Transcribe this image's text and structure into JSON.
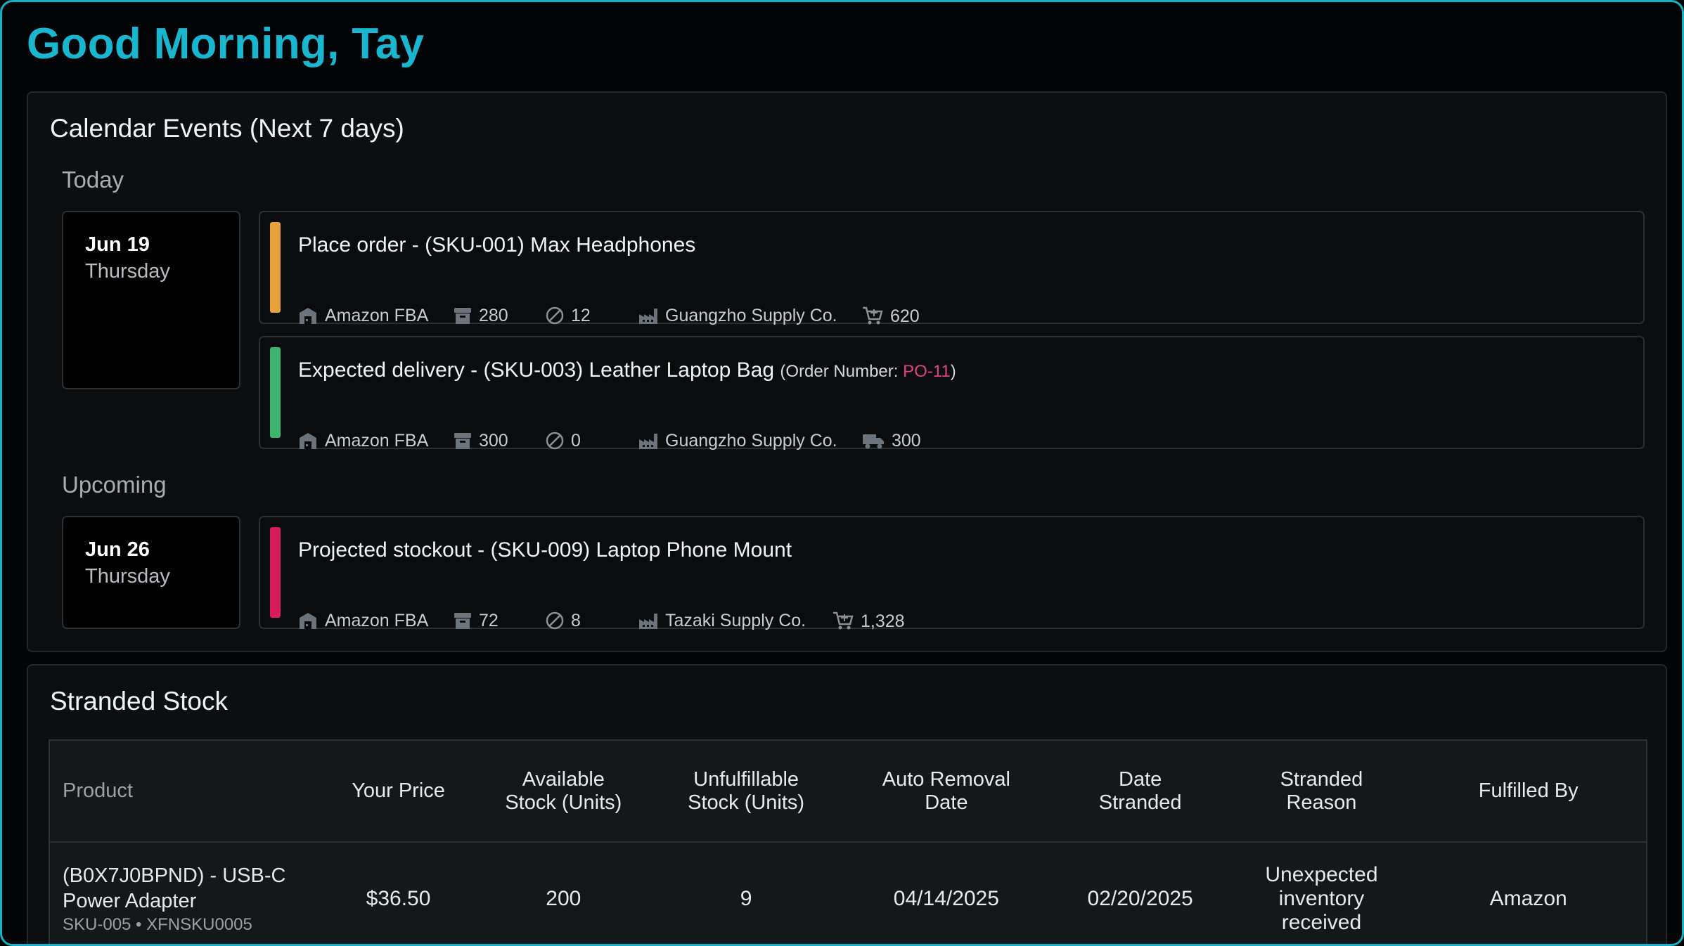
{
  "greeting": "Good Morning, Tay",
  "calendar": {
    "title": "Calendar Events (Next 7 days)",
    "today_label": "Today",
    "upcoming_label": "Upcoming",
    "today": {
      "date": "Jun 19",
      "weekday": "Thursday",
      "events": [
        {
          "title": "Place order - (SKU-001) Max Headphones",
          "bar_color": "#e9a23b",
          "channel": "Amazon FBA",
          "stock": "280",
          "unfulfillable": "12",
          "supplier": "Guangzho Supply Co.",
          "quantity_icon": "cart-icon",
          "quantity": "620"
        },
        {
          "title": "Expected delivery - (SKU-003) Leather Laptop Bag",
          "order_label": "(Order Number: ",
          "order_number": "PO-11",
          "order_close": ")",
          "bar_color": "#3cb46e",
          "channel": "Amazon FBA",
          "stock": "300",
          "unfulfillable": "0",
          "supplier": "Guangzho Supply Co.",
          "quantity_icon": "truck-icon",
          "quantity": "300"
        }
      ]
    },
    "upcoming": {
      "date": "Jun 26",
      "weekday": "Thursday",
      "events": [
        {
          "title": "Projected stockout - (SKU-009) Laptop Phone Mount",
          "bar_color": "#d81b5a",
          "channel": "Amazon FBA",
          "stock": "72",
          "unfulfillable": "8",
          "supplier": "Tazaki Supply Co.",
          "quantity_icon": "cart-icon",
          "quantity": "1,328"
        }
      ]
    }
  },
  "stranded": {
    "title": "Stranded Stock",
    "columns": [
      [
        "Product"
      ],
      [
        "Your Price"
      ],
      [
        "Available",
        "Stock (Units)"
      ],
      [
        "Unfulfillable",
        "Stock (Units)"
      ],
      [
        "Auto Removal",
        "Date"
      ],
      [
        "Date",
        "Stranded"
      ],
      [
        "Stranded",
        "Reason"
      ],
      [
        "Fulfilled By"
      ]
    ],
    "rows": [
      {
        "product_line1": "(B0X7J0BPND) - USB-C",
        "product_line2": "Power Adapter",
        "product_sku": "SKU-005 • XFNSKU0005",
        "price": "$36.50",
        "available": "200",
        "unfulfillable": "9",
        "auto_removal": "04/14/2025",
        "date_stranded": "02/20/2025",
        "reason_lines": [
          "Unexpected",
          "inventory",
          "received"
        ],
        "fulfilled_by": "Amazon"
      }
    ]
  }
}
